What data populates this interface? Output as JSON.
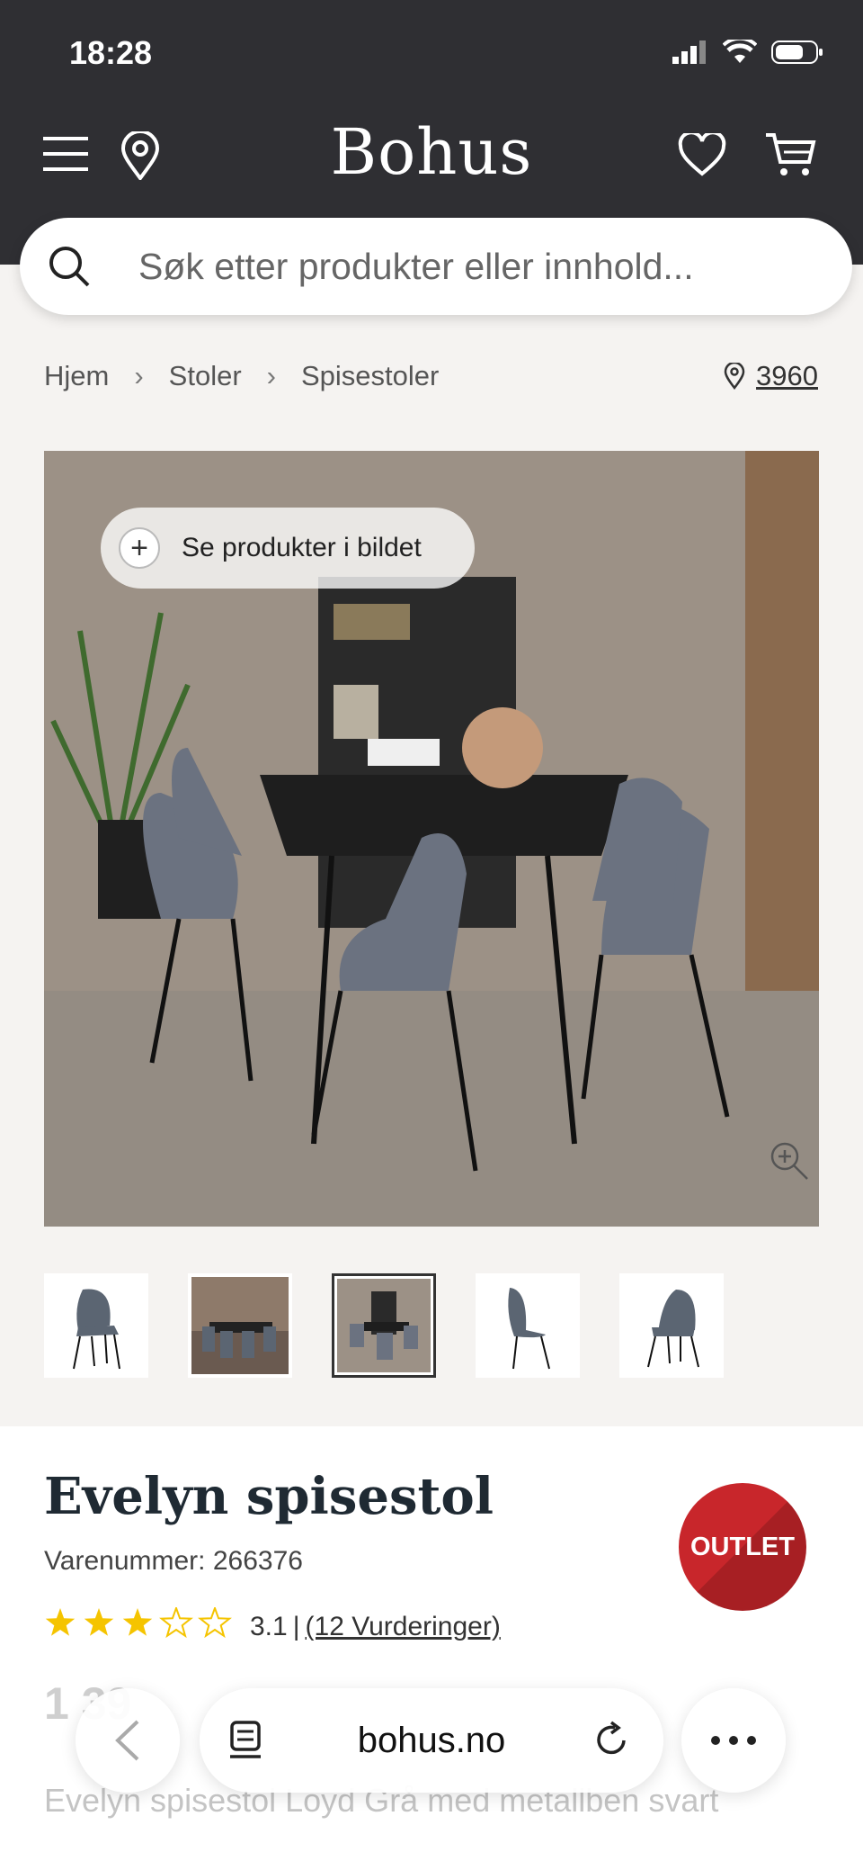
{
  "status": {
    "time": "18:28"
  },
  "header": {
    "logo": "Bohus"
  },
  "search": {
    "placeholder": "Søk etter produkter eller innhold..."
  },
  "breadcrumb": {
    "items": [
      "Hjem",
      "Stoler",
      "Spisestoler"
    ]
  },
  "store": {
    "number": "3960"
  },
  "hero": {
    "see_products_label": "Se produkter i bildet"
  },
  "product": {
    "title": "Evelyn spisestol",
    "sku_label": "Varenummer: 266376",
    "badge": "OUTLET",
    "rating_value": "3.1",
    "rating_separator": "|",
    "rating_count": "(12 Vurderinger)",
    "stars_filled": 3,
    "stars_total": 5,
    "price_partial": "1 39",
    "description": "Evelyn spisestol Loyd Grå med metallben svart"
  },
  "browser": {
    "url": "bohus.no"
  },
  "colors": {
    "header_bg": "#2f2f33",
    "outlet_red": "#c8262b",
    "star": "#f5c400"
  }
}
